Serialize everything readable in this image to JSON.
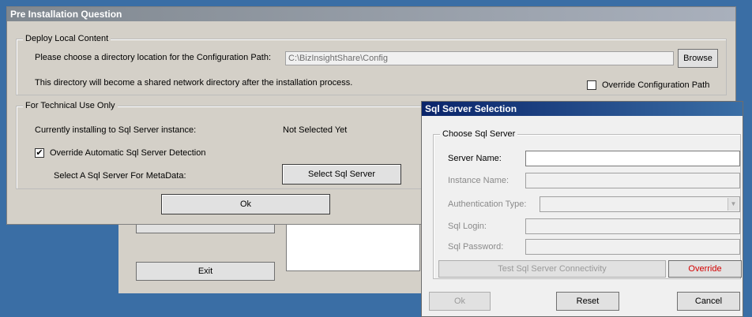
{
  "background_window": {
    "exit_label": "Exit"
  },
  "pre_install": {
    "title": "Pre Installation Question",
    "deploy_group": "Deploy Local Content",
    "config_prompt": "Please choose a directory location for the Configuration Path:",
    "config_path_value": "C:\\BizInsightShare\\Config",
    "browse_label": "Browse",
    "shared_note": "This directory will become a shared network directory after the installation process.",
    "override_config_label": "Override Configuration Path",
    "override_config_checked": false,
    "tech_group": "For Technical Use Only",
    "installing_label": "Currently installing to Sql Server instance:",
    "installing_value": "Not Selected Yet",
    "override_detection_label": "Override Automatic Sql Server Detection",
    "override_detection_checked": true,
    "select_server_label": "Select A Sql Server For MetaData:",
    "select_server_button": "Select Sql Server",
    "ok_label": "Ok"
  },
  "sql_dialog": {
    "title": "Sql Server Selection",
    "group": "Choose Sql Server",
    "server_name_label": "Server Name:",
    "server_name_value": "",
    "instance_name_label": "Instance Name:",
    "auth_type_label": "Authentication Type:",
    "sql_login_label": "Sql Login:",
    "sql_password_label": "Sql Password:",
    "test_button": "Test Sql Server Connectivity",
    "override_button": "Override",
    "ok_label": "Ok",
    "reset_label": "Reset",
    "cancel_label": "Cancel"
  },
  "colors": {
    "desktop": "#3a6ea5",
    "title_inactive": "#8c96a8",
    "title_active": "#0a246a",
    "override_red": "#d40000"
  }
}
